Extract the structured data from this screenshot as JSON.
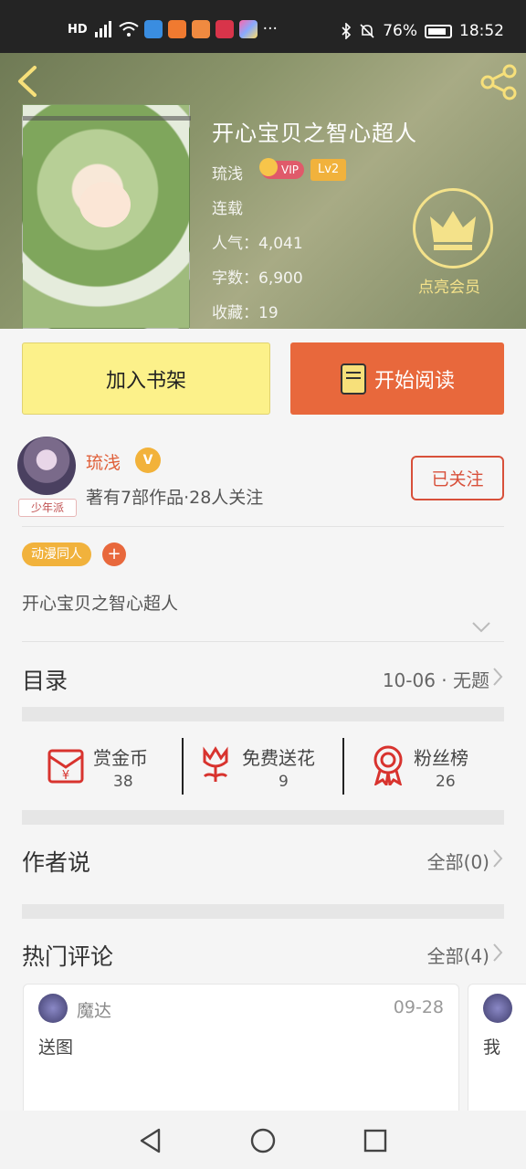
{
  "status_bar": {
    "battery": "76%",
    "time": "18:52",
    "net": "HD"
  },
  "book": {
    "title": "开心宝贝之智心超人",
    "author": "琉浅",
    "vip": "VIP",
    "level": "Lv2",
    "status": "连载",
    "popularity": "人气：4,041",
    "words": "字数：6,900",
    "favorites": "收藏：19",
    "member_label": "点亮会员"
  },
  "actions": {
    "add_shelf": "加入书架",
    "start_read": "开始阅读"
  },
  "author": {
    "name": "琉浅",
    "v": "V",
    "tag": "少年派",
    "stats": "著有7部作品·28人关注",
    "follow": "已关注"
  },
  "tags": {
    "category": "动漫同人",
    "add": "+"
  },
  "description": "开心宝贝之智心超人",
  "catalog": {
    "title": "目录",
    "latest": "10-06 · 无题"
  },
  "stats": [
    {
      "label": "赏金币",
      "value": "38"
    },
    {
      "label": "免费送花",
      "value": "9"
    },
    {
      "label": "粉丝榜",
      "value": "26"
    }
  ],
  "author_says": {
    "title": "作者说",
    "all": "全部(0)"
  },
  "hot_comments": {
    "title": "热门评论",
    "all": "全部(4)",
    "items": [
      {
        "name": "魔达",
        "date": "09-28",
        "text": "送图"
      },
      {
        "name": "",
        "date": "",
        "text": "我"
      }
    ]
  },
  "colors": {
    "accent": "#e8683c",
    "shelf": "#fcf18a",
    "gold": "#f1b23c"
  }
}
